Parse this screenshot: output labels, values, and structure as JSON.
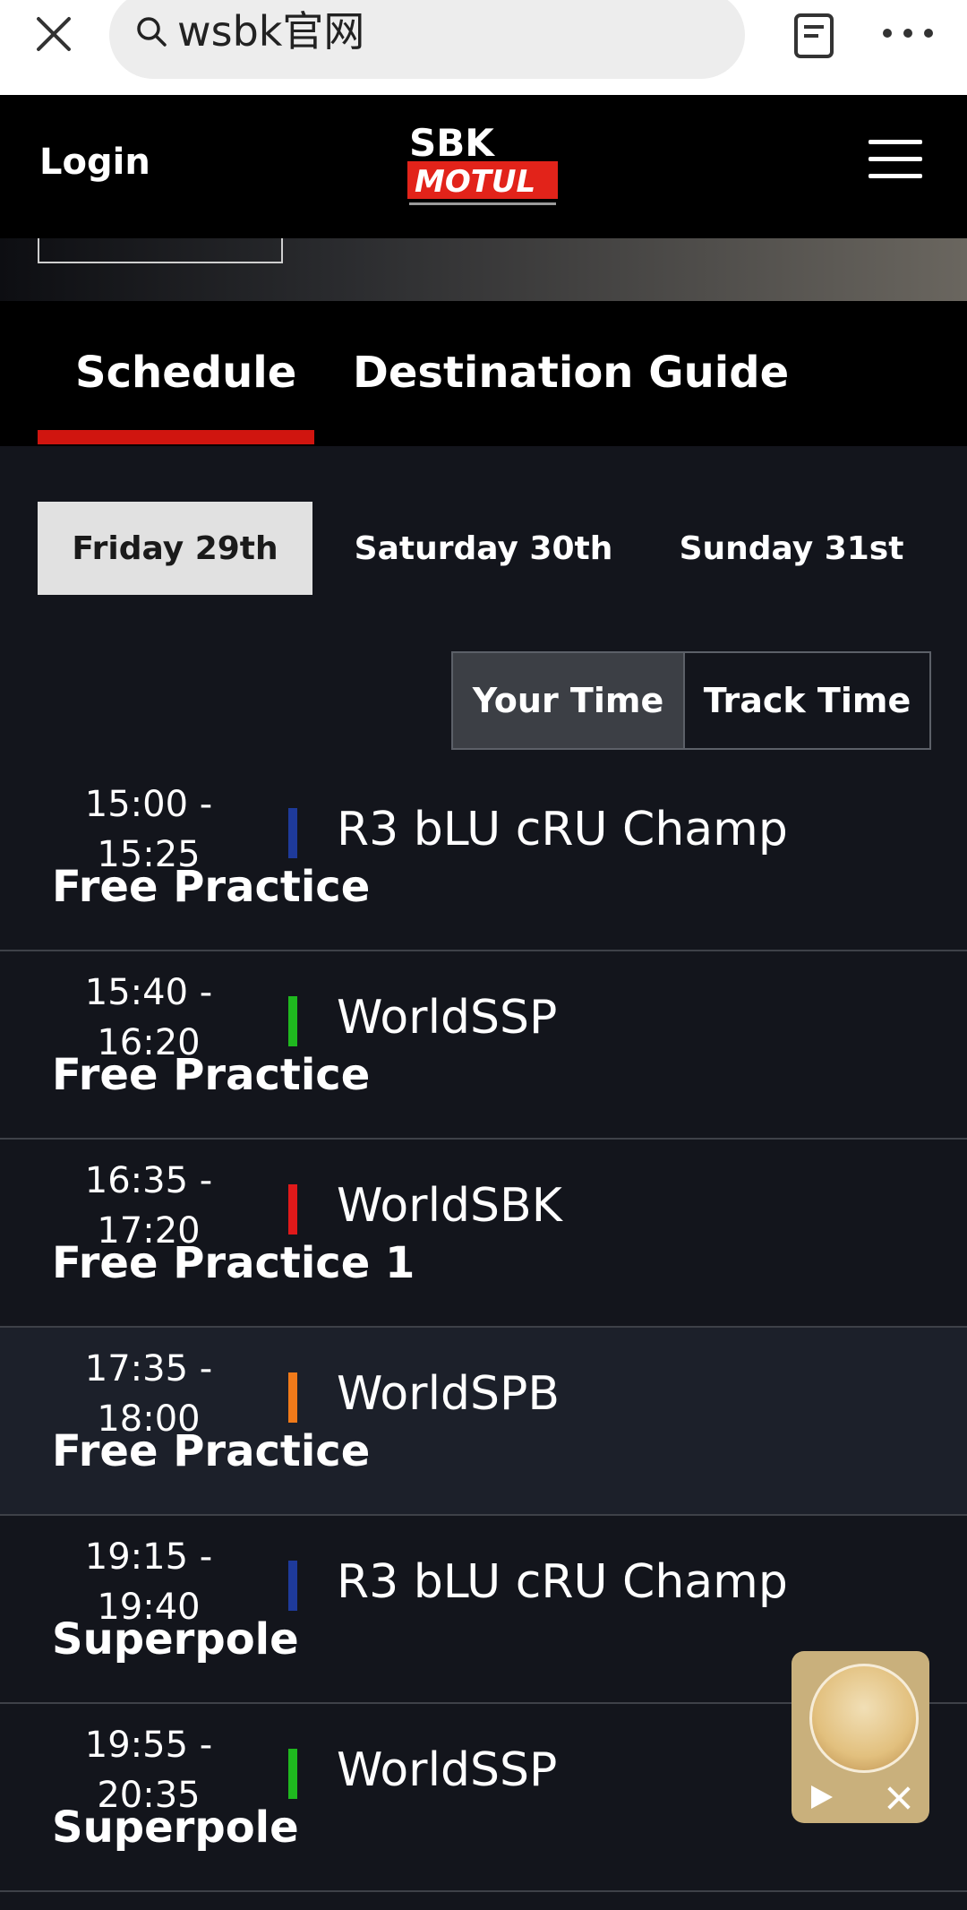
{
  "browser": {
    "search_text": "wsbk官网"
  },
  "header": {
    "login_label": "Login",
    "logo_text_top": "SBK",
    "logo_text_bottom": "MOTUL"
  },
  "tabs": [
    {
      "label": "Schedule",
      "active": true
    },
    {
      "label": "Destination Guide",
      "active": false
    }
  ],
  "days": [
    {
      "label": "Friday 29th",
      "selected": true
    },
    {
      "label": "Saturday 30th",
      "selected": false
    },
    {
      "label": "Sunday 31st",
      "selected": false
    }
  ],
  "time_toggle": {
    "your_time": "Your Time",
    "track_time": "Track Time",
    "selected": "Your Time"
  },
  "sessions": [
    {
      "time_start": "15:00 -",
      "time_end": "15:25",
      "series": "R3 bLU cRU Champ",
      "session": "Free Practice",
      "color": "#1e3a9a"
    },
    {
      "time_start": "15:40 -",
      "time_end": "16:20",
      "series": "WorldSSP",
      "session": "Free Practice",
      "color": "#1fb81f"
    },
    {
      "time_start": "16:35 -",
      "time_end": "17:20",
      "series": "WorldSBK",
      "session": "Free Practice 1",
      "color": "#e0191a"
    },
    {
      "time_start": "17:35 -",
      "time_end": "18:00",
      "series": "WorldSPB",
      "session": "Free Practice",
      "color": "#f07a1a"
    },
    {
      "time_start": "19:15 -",
      "time_end": "19:40",
      "series": "R3 bLU cRU Champ",
      "session": "Superpole",
      "color": "#1e3a9a"
    },
    {
      "time_start": "19:55 -",
      "time_end": "20:35",
      "series": "WorldSSP",
      "session": "Superpole",
      "color": "#1fb81f"
    }
  ]
}
